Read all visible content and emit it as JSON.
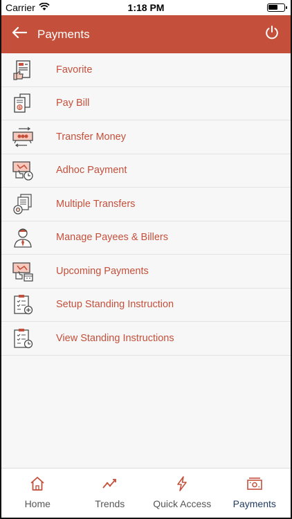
{
  "status_bar": {
    "carrier": "Carrier",
    "time": "1:18 PM",
    "battery_level": 0.6
  },
  "header": {
    "title": "Payments",
    "accent_color": "#c4503b"
  },
  "menu": {
    "items": [
      {
        "label": "Favorite",
        "icon": "favorite-receipt-icon"
      },
      {
        "label": "Pay Bill",
        "icon": "bill-icon"
      },
      {
        "label": "Transfer Money",
        "icon": "transfer-money-icon"
      },
      {
        "label": "Adhoc Payment",
        "icon": "adhoc-payment-icon"
      },
      {
        "label": "Multiple Transfers",
        "icon": "multiple-transfers-icon"
      },
      {
        "label": "Manage Payees & Billers",
        "icon": "payee-person-icon"
      },
      {
        "label": "Upcoming Payments",
        "icon": "upcoming-payments-icon"
      },
      {
        "label": "Setup Standing Instruction",
        "icon": "clipboard-add-icon"
      },
      {
        "label": "View Standing Instructions",
        "icon": "clipboard-view-icon"
      }
    ]
  },
  "tabs": [
    {
      "label": "Home",
      "icon": "home-icon",
      "active": false
    },
    {
      "label": "Trends",
      "icon": "trends-icon",
      "active": false
    },
    {
      "label": "Quick Access",
      "icon": "lightning-icon",
      "active": false
    },
    {
      "label": "Payments",
      "icon": "payments-icon",
      "active": true
    }
  ],
  "colors": {
    "accent": "#c4503b",
    "active_tab": "#1f3a5f",
    "icon_gray": "#4a4a4a"
  }
}
